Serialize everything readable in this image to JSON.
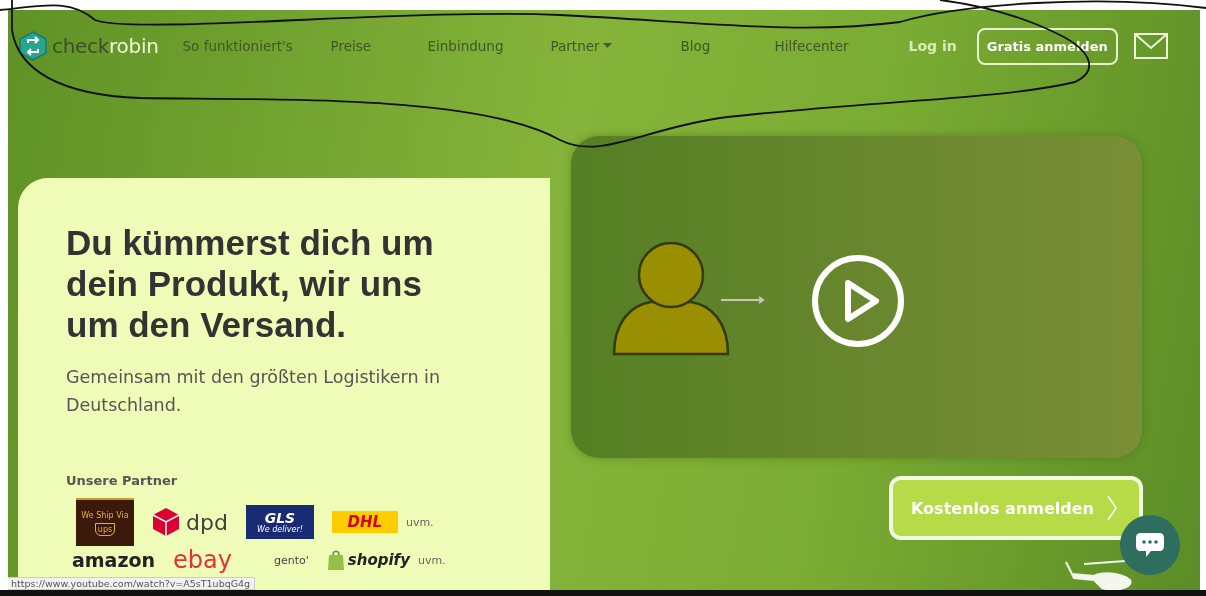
{
  "nav": {
    "logo": {
      "part_1": "check",
      "part_2": "robin"
    },
    "links": [
      {
        "label": "So funktioniert's",
        "dropdown": false
      },
      {
        "label": "Preise",
        "dropdown": false
      },
      {
        "label": "Einbindung",
        "dropdown": false
      },
      {
        "label": "Partner",
        "dropdown": true
      },
      {
        "label": "Blog",
        "dropdown": false
      },
      {
        "label": "Hilfecenter",
        "dropdown": false
      }
    ],
    "login": "Log in",
    "signup": "Gratis anmelden"
  },
  "hero": {
    "headline": "Du kümmerst dich um dein Produkt, wir uns um den Versand.",
    "subtitle": "Gemeinsam mit den größten Logistikern in Deutschland.",
    "partners_label": "Unsere Partner",
    "partner_rows": [
      [
        {
          "kind": "ups",
          "text": "ups",
          "tagline": "We Ship Via"
        },
        {
          "kind": "dpd",
          "text": "dpd"
        },
        {
          "kind": "gls",
          "text": "GLS",
          "tagline": "We deliver!"
        },
        {
          "kind": "dhl",
          "text": "DHL"
        },
        {
          "kind": "more",
          "text": "uvm."
        }
      ],
      [
        {
          "kind": "amazon",
          "text": "amazon"
        },
        {
          "kind": "ebay",
          "text": "ebay"
        },
        {
          "kind": "magento",
          "text": "gento'"
        },
        {
          "kind": "shopify",
          "text": "shopify"
        },
        {
          "kind": "more",
          "text": "uvm."
        }
      ]
    ]
  },
  "cta": "Kostenlos anmelden",
  "status_url": "https://www.youtube.com/watch?v=A5sT1ubqG4g"
}
